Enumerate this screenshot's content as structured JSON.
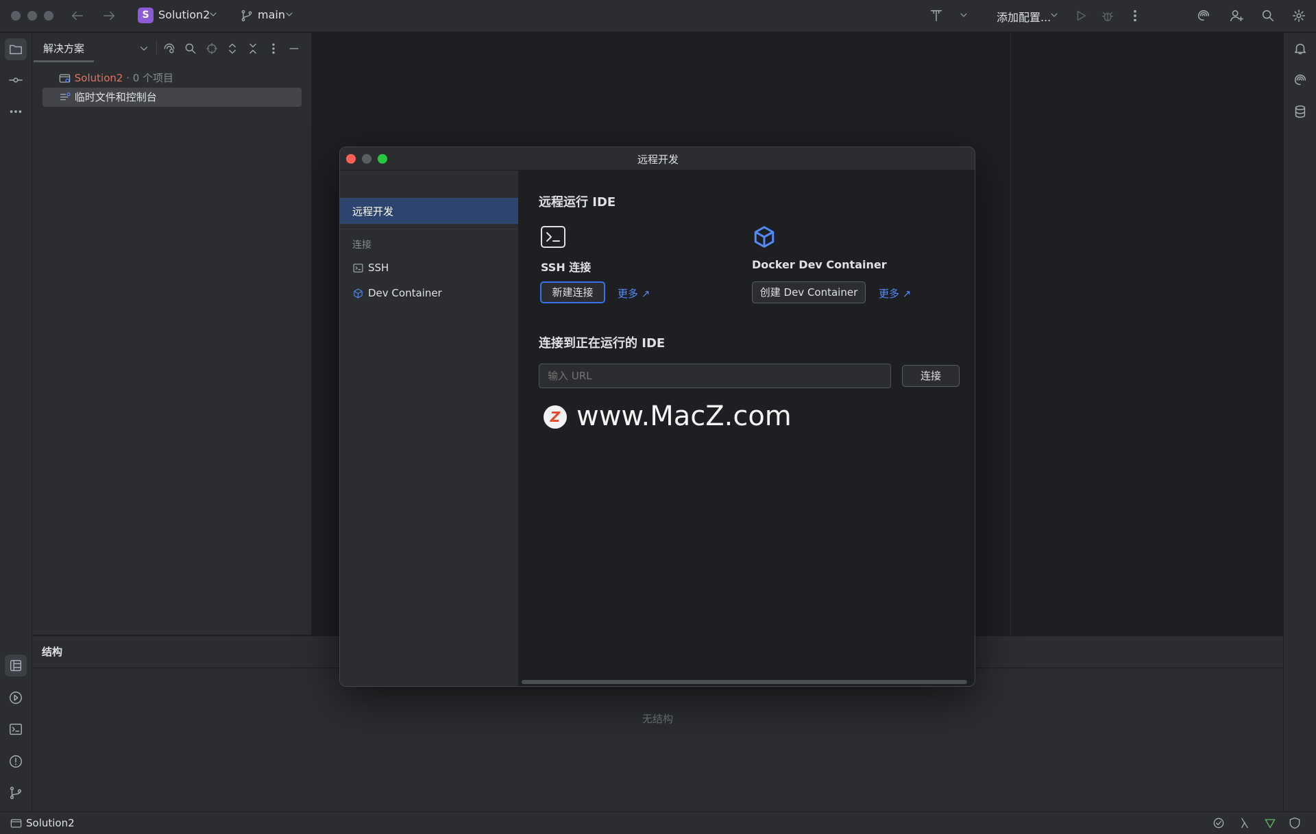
{
  "titlebar": {
    "project_initial": "S",
    "project_name": "Solution2",
    "branch": "main",
    "run_config": "添加配置..."
  },
  "project_panel": {
    "title": "解决方案",
    "tree": [
      {
        "label": "Solution2",
        "suffix": " · 0 个项目",
        "color": "#e2735d"
      },
      {
        "label": "临时文件和控制台"
      }
    ]
  },
  "structure_panel": {
    "title": "结构",
    "empty_text": "无结构"
  },
  "statusbar": {
    "project": "Solution2"
  },
  "dialog": {
    "title": "远程开发",
    "sidebar": {
      "selected": "远程开发",
      "section_header": "连接",
      "items": [
        {
          "label": "SSH",
          "icon": "terminal-icon"
        },
        {
          "label": "Dev Container",
          "icon": "cube-icon"
        }
      ]
    },
    "section1_title": "远程运行 IDE",
    "ssh": {
      "label": "SSH 连接",
      "button": "新建连接",
      "more": "更多 ↗"
    },
    "docker": {
      "label": "Docker Dev Container",
      "button": "创建 Dev Container",
      "more": "更多 ↗"
    },
    "section2_title": "连接到正在运行的 IDE",
    "url_placeholder": "输入 URL",
    "connect_button": "连接",
    "watermark": "www.MacZ.com",
    "watermark_badge": "Z"
  },
  "colors": {
    "accent": "#3574f0",
    "link": "#548af7",
    "selection": "#2e436e",
    "project_badge": "#8b5cd6"
  }
}
